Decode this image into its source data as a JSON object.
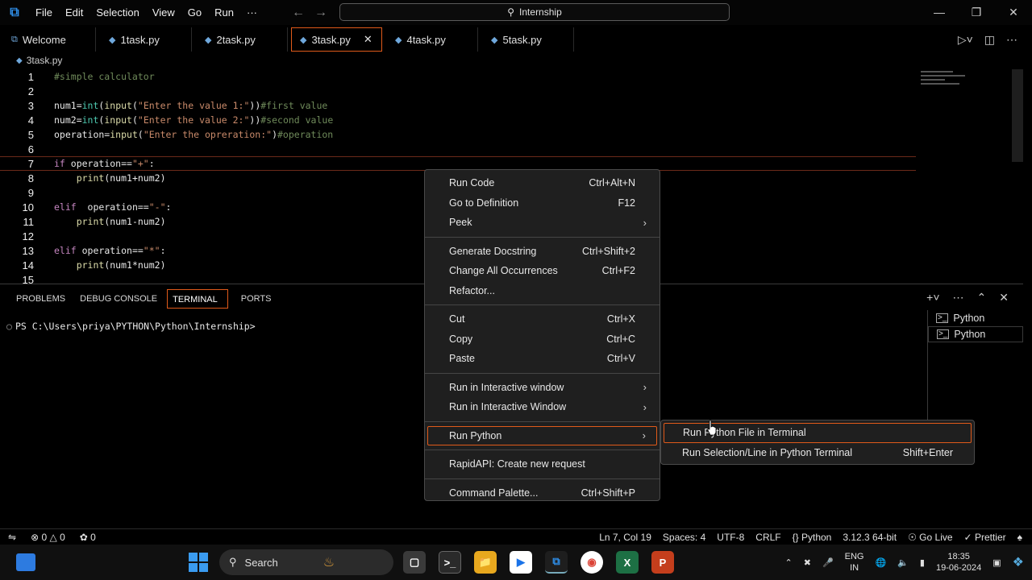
{
  "titlebar": {
    "menu": [
      "File",
      "Edit",
      "Selection",
      "View",
      "Go",
      "Run",
      "···"
    ],
    "search": "Internship"
  },
  "tabs": [
    {
      "label": "Welcome",
      "icon": "vscode-icon"
    },
    {
      "label": "1task.py",
      "icon": "python-icon"
    },
    {
      "label": "2task.py",
      "icon": "python-icon"
    },
    {
      "label": "3task.py",
      "icon": "python-icon",
      "active": true
    },
    {
      "label": "4task.py",
      "icon": "python-icon"
    },
    {
      "label": "5task.py",
      "icon": "python-icon"
    }
  ],
  "breadcrumb": "3task.py",
  "code_lines": [
    "1",
    "2",
    "3",
    "4",
    "5",
    "6",
    "7",
    "8",
    "9",
    "10",
    "11",
    "12",
    "13",
    "14",
    "15"
  ],
  "panel": {
    "tabs": [
      "PROBLEMS",
      "DEBUG CONSOLE",
      "TERMINAL",
      "PORTS"
    ],
    "prompt": "PS C:\\Users\\priya\\PYTHON\\Python\\Internship>",
    "terminals": [
      "Python",
      "Python"
    ]
  },
  "context_menu": [
    {
      "label": "Run Code",
      "shortcut": "Ctrl+Alt+N"
    },
    {
      "label": "Go to Definition",
      "shortcut": "F12"
    },
    {
      "label": "Peek",
      "shortcut": ""
    },
    {
      "label": "Generate Docstring",
      "shortcut": "Ctrl+Shift+2"
    },
    {
      "label": "Change All Occurrences",
      "shortcut": "Ctrl+F2"
    },
    {
      "label": "Refactor...",
      "shortcut": ""
    },
    {
      "label": "Cut",
      "shortcut": "Ctrl+X"
    },
    {
      "label": "Copy",
      "shortcut": "Ctrl+C"
    },
    {
      "label": "Paste",
      "shortcut": "Ctrl+V"
    },
    {
      "label": "Run in Interactive window",
      "shortcut": ""
    },
    {
      "label": "Run in Interactive Window",
      "shortcut": ""
    },
    {
      "label": "Run Python",
      "shortcut": ""
    },
    {
      "label": "RapidAPI: Create new request",
      "shortcut": ""
    },
    {
      "label": "Command Palette...",
      "shortcut": "Ctrl+Shift+P"
    }
  ],
  "submenu": [
    {
      "label": "Run Python File in Terminal",
      "shortcut": ""
    },
    {
      "label": "Run Selection/Line in Python Terminal",
      "shortcut": "Shift+Enter"
    }
  ],
  "status": {
    "errors": "0",
    "warnings": "0",
    "ports": "0",
    "position": "Ln 7, Col 19",
    "spaces": "Spaces: 4",
    "encoding": "UTF-8",
    "eol": "CRLF",
    "language": "Python",
    "interpreter": "3.12.3 64-bit",
    "golive": "Go Live",
    "prettier": "Prettier"
  },
  "taskbar": {
    "search": "Search",
    "lang1": "ENG",
    "lang2": "IN",
    "time": "18:35",
    "date": "19-06-2024"
  }
}
